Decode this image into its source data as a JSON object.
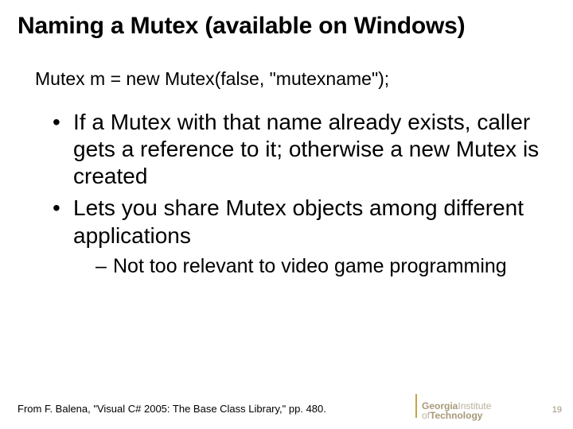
{
  "title": "Naming a Mutex (available on Windows)",
  "code": "Mutex m = new Mutex(false, \"mutexname\");",
  "bullets": [
    "If a Mutex with that name already exists, caller gets a reference to it; otherwise a new Mutex is created",
    "Lets you share Mutex objects among different applications"
  ],
  "sub_bullets": [
    "Not too relevant to video game programming"
  ],
  "citation": "From F. Balena, \"Visual C# 2005: The Base Class Library,\" pp. 480.",
  "page_number": "19",
  "logo": {
    "line1": "Georgia",
    "line1b": "Institute",
    "line2a": "of",
    "line2b": "Technology"
  }
}
